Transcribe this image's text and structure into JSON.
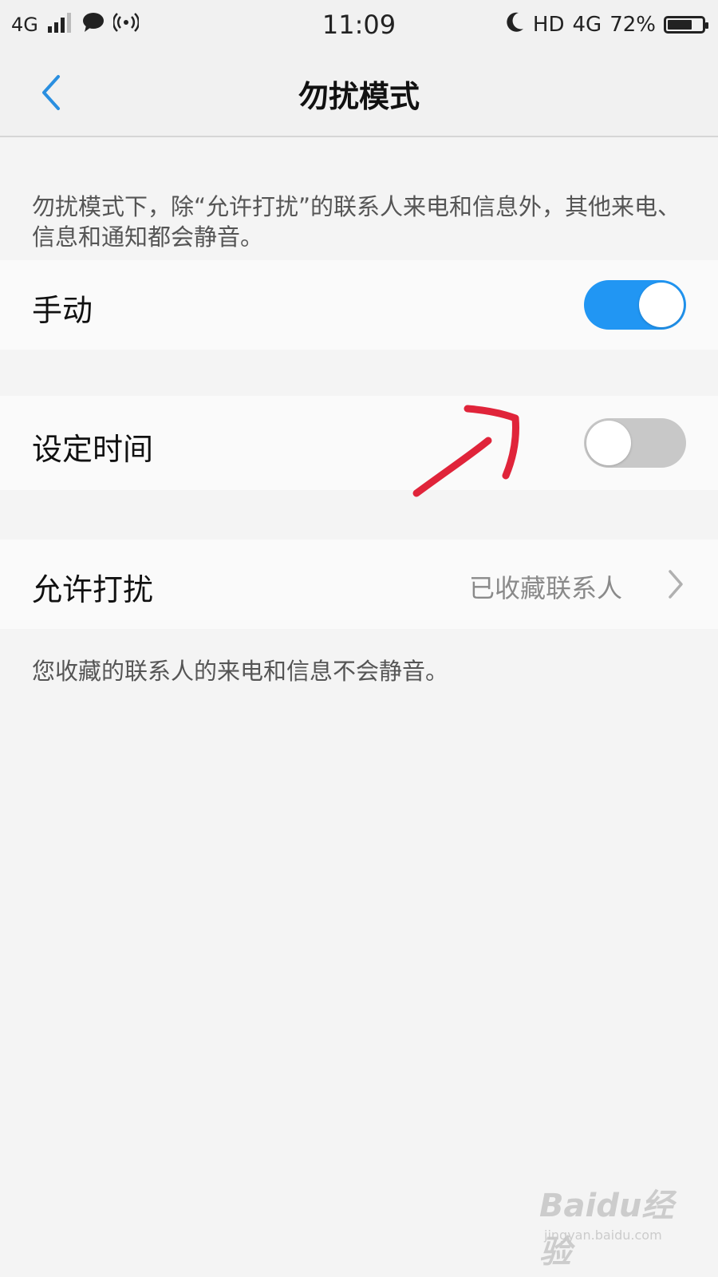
{
  "status_bar": {
    "network": "4G",
    "time": "11:09",
    "hd": "HD",
    "network_right": "4G",
    "battery": "72%",
    "battery_level": 0.72
  },
  "header": {
    "title": "勿扰模式"
  },
  "description": "勿扰模式下，除“允许打扰”的联系人来电和信息外，其他来电、信息和通知都会静音。",
  "rows": {
    "manual": {
      "label": "手动",
      "on": true
    },
    "schedule": {
      "label": "设定时间",
      "on": false
    },
    "allow": {
      "label": "允许打扰",
      "value": "已收藏联系人"
    }
  },
  "footnote": "您收藏的联系人的来电和信息不会静音。",
  "watermark": {
    "brand": "Baidu经验",
    "url": "jingyan.baidu.com"
  },
  "colors": {
    "toggle_on": "#2196f3",
    "toggle_off": "#c8c8c8",
    "accent": "#2a8fe0",
    "annotation": "#e0243a"
  },
  "icons": {
    "back": "chevron-left-icon",
    "chevron": "chevron-right-icon",
    "signal": "signal-icon",
    "message": "message-icon",
    "hotspot": "hotspot-icon",
    "moon": "moon-icon",
    "battery": "battery-icon"
  }
}
